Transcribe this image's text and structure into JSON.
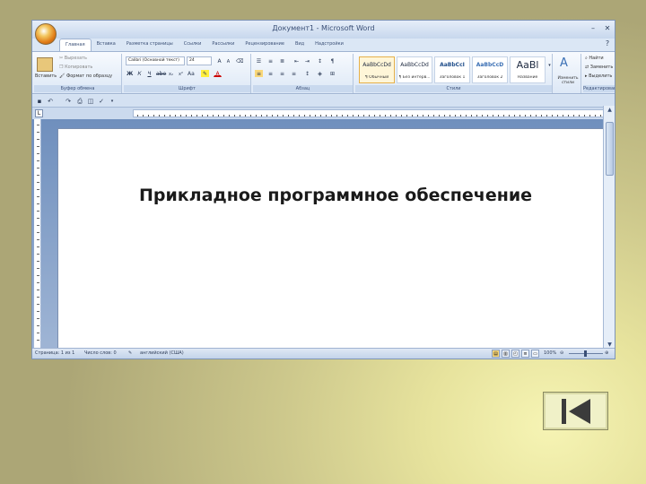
{
  "window": {
    "title": "Документ1 - Microsoft Word",
    "tabs": [
      "Главная",
      "Вставка",
      "Разметка страницы",
      "Ссылки",
      "Рассылки",
      "Рецензирование",
      "Вид",
      "Надстройки"
    ],
    "active_tab": "Главная"
  },
  "ribbon": {
    "clipboard": {
      "label": "Буфер обмена",
      "paste": "Вставить",
      "cut": "Вырезать",
      "copy": "Копировать",
      "format_painter": "Формат по образцу"
    },
    "font": {
      "label": "Шрифт",
      "font_name": "Calibri (Основной текст)",
      "font_size": "24"
    },
    "paragraph": {
      "label": "Абзац"
    },
    "styles": {
      "label": "Стили",
      "items": [
        {
          "sample": "AaBbCcDd",
          "name": "¶ Обычный"
        },
        {
          "sample": "AaBbCcDd",
          "name": "¶ Без интерв..."
        },
        {
          "sample": "AaBbCcI",
          "name": "Заголовок 1"
        },
        {
          "sample": "AaBbCcD",
          "name": "Заголовок 2"
        },
        {
          "sample": "AaBl",
          "name": "Название"
        }
      ],
      "change_styles": "Изменить стили"
    },
    "editing": {
      "label": "Редактирование",
      "find": "Найти",
      "replace": "Заменить",
      "select": "Выделить"
    }
  },
  "document": {
    "heading": "Прикладное программное обеспечение"
  },
  "statusbar": {
    "page": "Страница: 1 из 1",
    "words": "Число слов: 0",
    "language": "английский (США)",
    "zoom": "100%"
  },
  "navigation": {
    "back_icon": "skip-back-icon"
  }
}
